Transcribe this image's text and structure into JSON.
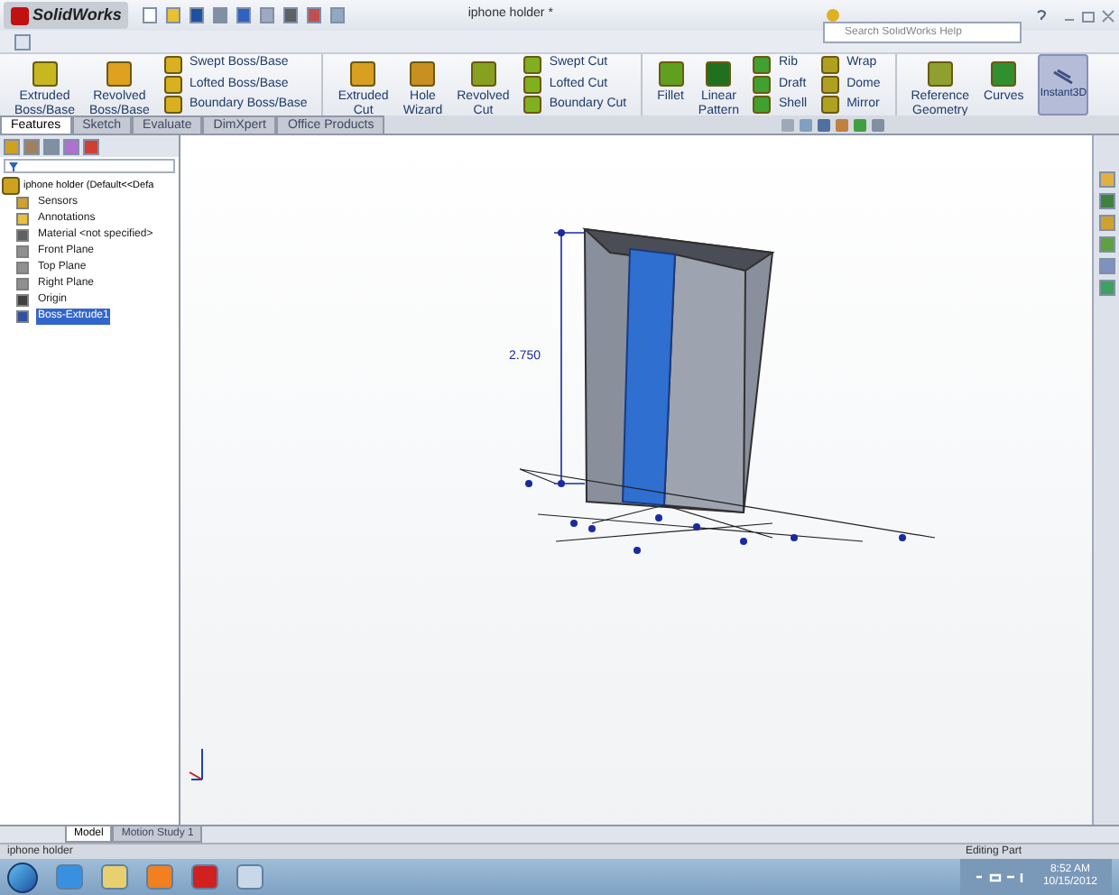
{
  "app": {
    "name": "SolidWorks"
  },
  "window": {
    "title": "iphone holder *"
  },
  "search": {
    "placeholder": "Search SolidWorks Help"
  },
  "ribbon": [
    {
      "kind": "large",
      "label": "Extruded\nBoss/Base"
    },
    {
      "kind": "large",
      "label": "Revolved\nBoss/Base"
    },
    {
      "kind": "stack",
      "items": [
        "Swept Boss/Base",
        "Lofted Boss/Base",
        "Boundary Boss/Base"
      ]
    },
    {
      "kind": "sep"
    },
    {
      "kind": "large",
      "label": "Extruded\nCut"
    },
    {
      "kind": "large",
      "label": "Hole\nWizard"
    },
    {
      "kind": "large",
      "label": "Revolved\nCut"
    },
    {
      "kind": "stack",
      "items": [
        "Swept Cut",
        "Lofted Cut",
        "Boundary Cut"
      ]
    },
    {
      "kind": "sep"
    },
    {
      "kind": "large",
      "label": "Fillet"
    },
    {
      "kind": "large",
      "label": "Linear\nPattern"
    },
    {
      "kind": "stack",
      "items": [
        "Rib",
        "Draft",
        "Shell"
      ]
    },
    {
      "kind": "stack",
      "items": [
        "Wrap",
        "Dome",
        "Mirror"
      ]
    },
    {
      "kind": "sep"
    },
    {
      "kind": "large",
      "label": "Reference\nGeometry"
    },
    {
      "kind": "large",
      "label": "Curves"
    },
    {
      "kind": "toggle",
      "label": "Instant3D",
      "selected": true
    }
  ],
  "tabs": [
    {
      "label": "Features",
      "selected": true
    },
    {
      "label": "Sketch",
      "selected": false
    },
    {
      "label": "Evaluate",
      "selected": false
    },
    {
      "label": "DimXpert",
      "selected": false
    },
    {
      "label": "Office Products",
      "selected": false
    }
  ],
  "tree": {
    "root": "iphone holder  (Default<<Defa",
    "children": [
      {
        "kind": "sensor",
        "label": "Sensors",
        "selected": false
      },
      {
        "kind": "annotation",
        "label": "Annotations",
        "selected": false
      },
      {
        "kind": "material",
        "label": "Material <not specified>",
        "selected": false
      },
      {
        "kind": "plane",
        "label": "Front Plane",
        "selected": false
      },
      {
        "kind": "plane",
        "label": "Top Plane",
        "selected": false
      },
      {
        "kind": "plane",
        "label": "Right Plane",
        "selected": false
      },
      {
        "kind": "origin",
        "label": "Origin",
        "selected": false
      },
      {
        "kind": "feature",
        "label": "Boss-Extrude1",
        "selected": true
      }
    ]
  },
  "dimension": "2.750",
  "bottom_tabs": [
    {
      "label": "Model",
      "selected": true
    },
    {
      "label": "Motion Study 1",
      "selected": false
    }
  ],
  "status_bar": {
    "document": "iphone holder",
    "mode": "Editing Part"
  },
  "taskbar": {
    "time": "8:52 AM",
    "date": "10/15/2012"
  }
}
